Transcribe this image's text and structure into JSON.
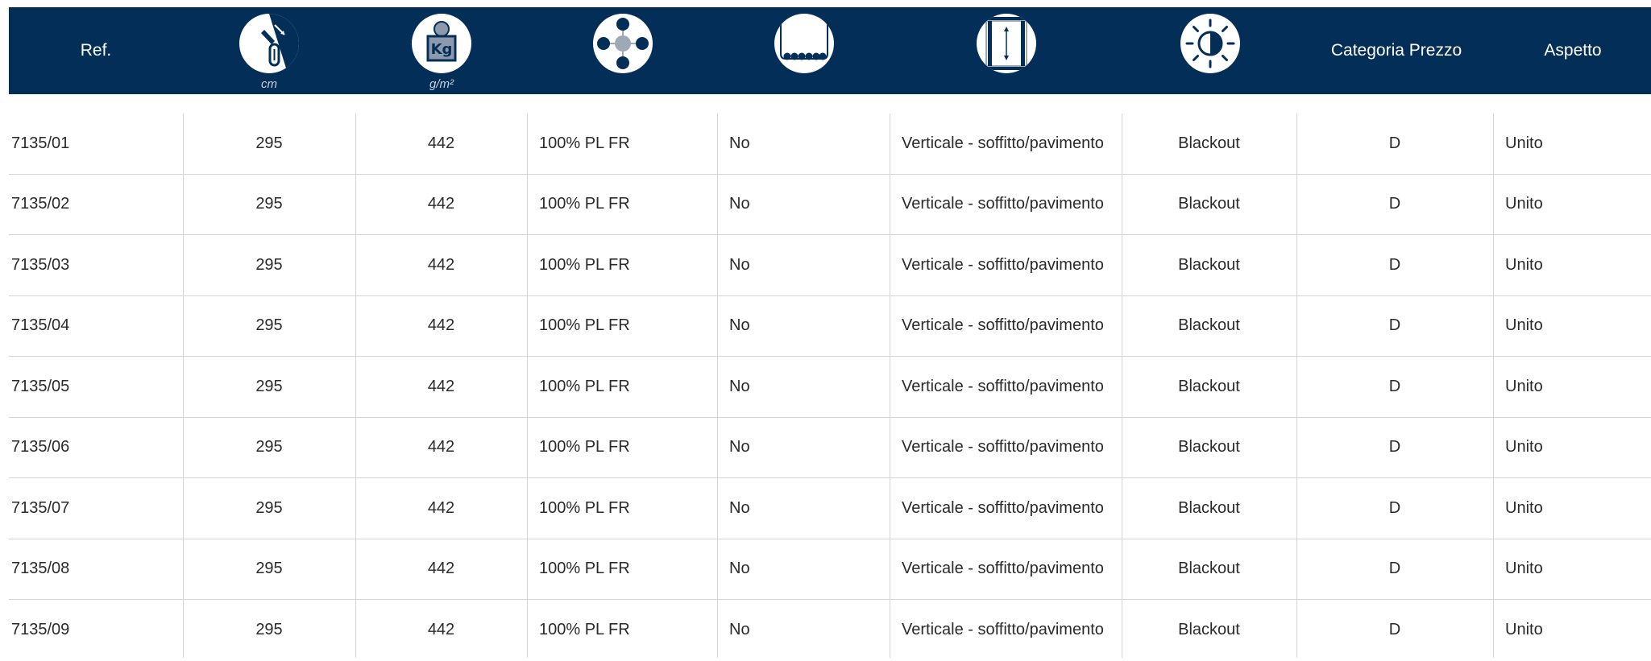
{
  "header": {
    "ref": "Ref.",
    "width_unit": "cm",
    "weight_icon_text": "Kg",
    "weight_unit": "g/m²",
    "price_category": "Categoria Prezzo",
    "aspect": "Aspetto",
    "icons": [
      "width-icon",
      "weight-icon",
      "composition-icon",
      "weighted-hem-icon",
      "orientation-icon",
      "light-icon"
    ]
  },
  "colors": {
    "header_bg": "#032e58",
    "text": "#2a2a2a",
    "grid": "#d4d4d4"
  },
  "rows": [
    {
      "ref": "7135/01",
      "width": "295",
      "weight": "442",
      "composition": "100% PL FR",
      "weighted_hem": "No",
      "orientation": "Verticale - soffitto/pavimento",
      "light": "Blackout",
      "price": "D",
      "aspect": "Unito"
    },
    {
      "ref": "7135/02",
      "width": "295",
      "weight": "442",
      "composition": "100% PL FR",
      "weighted_hem": "No",
      "orientation": "Verticale - soffitto/pavimento",
      "light": "Blackout",
      "price": "D",
      "aspect": "Unito"
    },
    {
      "ref": "7135/03",
      "width": "295",
      "weight": "442",
      "composition": "100% PL FR",
      "weighted_hem": "No",
      "orientation": "Verticale - soffitto/pavimento",
      "light": "Blackout",
      "price": "D",
      "aspect": "Unito"
    },
    {
      "ref": "7135/04",
      "width": "295",
      "weight": "442",
      "composition": "100% PL FR",
      "weighted_hem": "No",
      "orientation": "Verticale - soffitto/pavimento",
      "light": "Blackout",
      "price": "D",
      "aspect": "Unito"
    },
    {
      "ref": "7135/05",
      "width": "295",
      "weight": "442",
      "composition": "100% PL FR",
      "weighted_hem": "No",
      "orientation": "Verticale - soffitto/pavimento",
      "light": "Blackout",
      "price": "D",
      "aspect": "Unito"
    },
    {
      "ref": "7135/06",
      "width": "295",
      "weight": "442",
      "composition": "100% PL FR",
      "weighted_hem": "No",
      "orientation": "Verticale - soffitto/pavimento",
      "light": "Blackout",
      "price": "D",
      "aspect": "Unito"
    },
    {
      "ref": "7135/07",
      "width": "295",
      "weight": "442",
      "composition": "100% PL FR",
      "weighted_hem": "No",
      "orientation": "Verticale - soffitto/pavimento",
      "light": "Blackout",
      "price": "D",
      "aspect": "Unito"
    },
    {
      "ref": "7135/08",
      "width": "295",
      "weight": "442",
      "composition": "100% PL FR",
      "weighted_hem": "No",
      "orientation": "Verticale - soffitto/pavimento",
      "light": "Blackout",
      "price": "D",
      "aspect": "Unito"
    },
    {
      "ref": "7135/09",
      "width": "295",
      "weight": "442",
      "composition": "100% PL FR",
      "weighted_hem": "No",
      "orientation": "Verticale - soffitto/pavimento",
      "light": "Blackout",
      "price": "D",
      "aspect": "Unito"
    }
  ]
}
